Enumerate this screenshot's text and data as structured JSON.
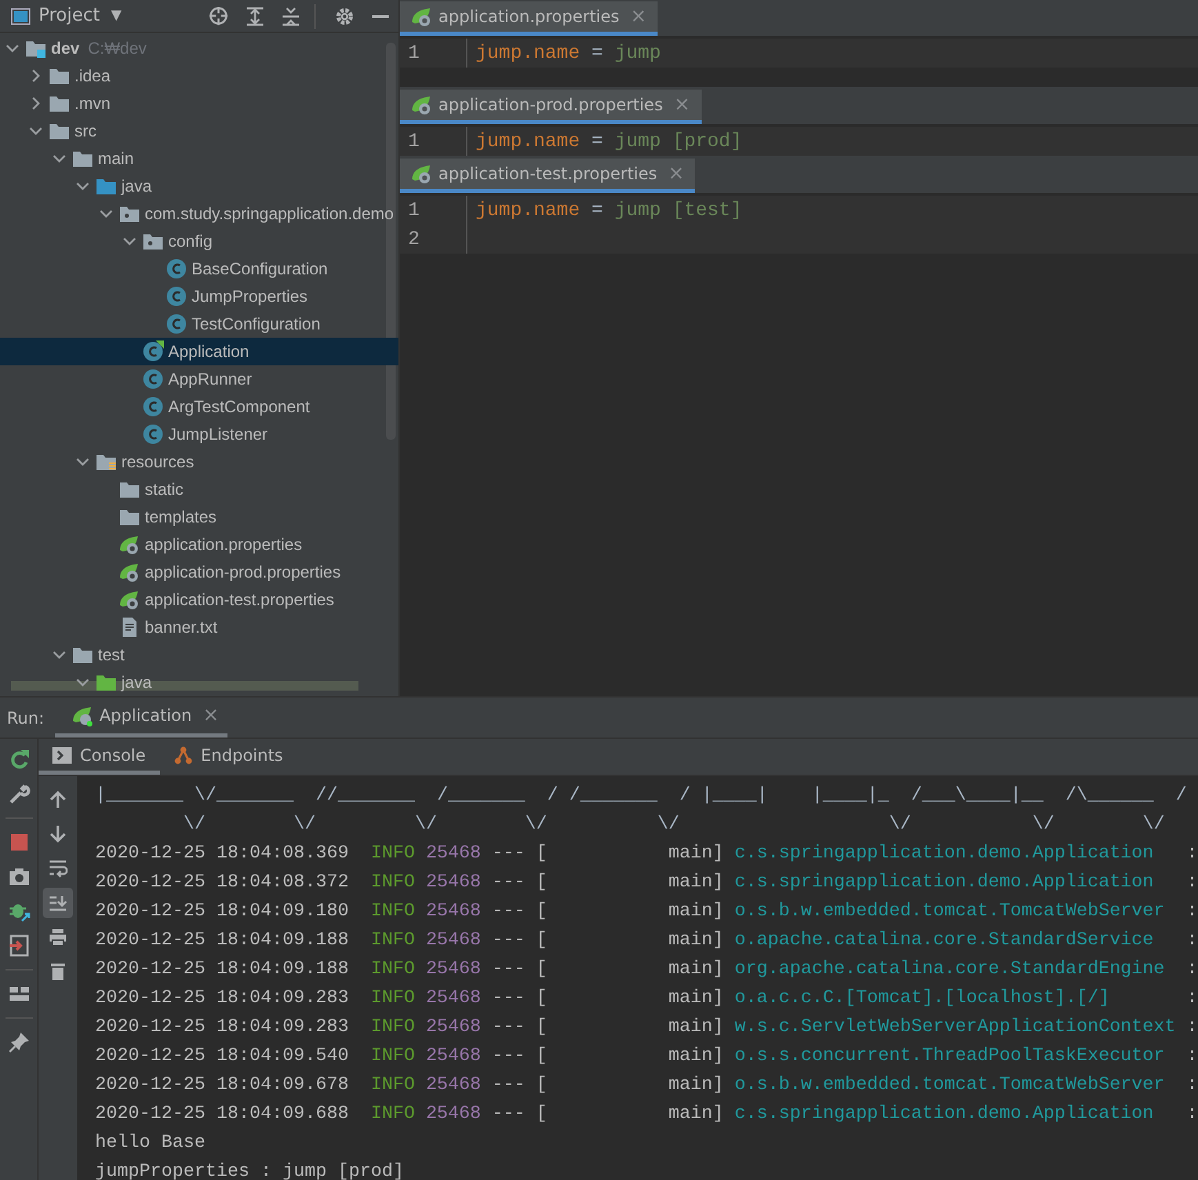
{
  "project_panel": {
    "title": "Project",
    "caret": "▼",
    "tree": [
      {
        "label": "dev",
        "hint": "C:₩dev",
        "kind": "module",
        "expanded": true,
        "selected": false,
        "children": [
          {
            "label": ".idea",
            "kind": "folder",
            "expanded": false,
            "selected": false
          },
          {
            "label": ".mvn",
            "kind": "folder",
            "expanded": false,
            "selected": false
          },
          {
            "label": "src",
            "kind": "folder",
            "expanded": true,
            "selected": false,
            "children": [
              {
                "label": "main",
                "kind": "folder",
                "expanded": true,
                "selected": false,
                "children": [
                  {
                    "label": "java",
                    "kind": "source",
                    "expanded": true,
                    "selected": false,
                    "children": [
                      {
                        "label": "com.study.springapplication.demo",
                        "kind": "package",
                        "expanded": true,
                        "selected": false,
                        "children": [
                          {
                            "label": "config",
                            "kind": "package",
                            "expanded": true,
                            "selected": false,
                            "children": [
                              {
                                "label": "BaseConfiguration",
                                "kind": "class",
                                "selected": false
                              },
                              {
                                "label": "JumpProperties",
                                "kind": "class",
                                "selected": false
                              },
                              {
                                "label": "TestConfiguration",
                                "kind": "class",
                                "selected": false
                              }
                            ]
                          },
                          {
                            "label": "Application",
                            "kind": "spring-class",
                            "selected": true
                          },
                          {
                            "label": "AppRunner",
                            "kind": "class",
                            "selected": false
                          },
                          {
                            "label": "ArgTestComponent",
                            "kind": "class",
                            "selected": false
                          },
                          {
                            "label": "JumpListener",
                            "kind": "class",
                            "selected": false
                          }
                        ]
                      }
                    ]
                  },
                  {
                    "label": "resources",
                    "kind": "resources",
                    "expanded": true,
                    "selected": false,
                    "children": [
                      {
                        "label": "static",
                        "kind": "folder",
                        "selected": false
                      },
                      {
                        "label": "templates",
                        "kind": "folder",
                        "selected": false
                      },
                      {
                        "label": "application.properties",
                        "kind": "properties",
                        "selected": false
                      },
                      {
                        "label": "application-prod.properties",
                        "kind": "properties",
                        "selected": false
                      },
                      {
                        "label": "application-test.properties",
                        "kind": "properties",
                        "selected": false
                      },
                      {
                        "label": "banner.txt",
                        "kind": "text",
                        "selected": false
                      }
                    ]
                  }
                ]
              },
              {
                "label": "test",
                "kind": "folder",
                "expanded": true,
                "selected": false,
                "children": [
                  {
                    "label": "java",
                    "kind": "test-source",
                    "expanded": true,
                    "selected": false
                  }
                ]
              }
            ]
          }
        ]
      }
    ]
  },
  "editors": [
    {
      "tab": "application.properties",
      "close": "×",
      "lines": [
        {
          "number": "1",
          "key": "jump.name",
          "op": "=",
          "value": "jump"
        }
      ]
    },
    {
      "tab": "application-prod.properties",
      "close": "×",
      "lines": [
        {
          "number": "1",
          "key": "jump.name",
          "op": "=",
          "value": "jump [prod]"
        }
      ]
    },
    {
      "tab": "application-test.properties",
      "close": "×",
      "lines": [
        {
          "number": "1",
          "key": "jump.name",
          "op": "=",
          "value": "jump [test]"
        },
        {
          "number": "2"
        }
      ]
    }
  ],
  "run_panel": {
    "label": "Run:",
    "tab": "Application",
    "close": "×",
    "subtabs": [
      {
        "label": "Console",
        "kind": "console",
        "selected": true
      },
      {
        "label": "Endpoints",
        "kind": "endpoints",
        "selected": false
      }
    ],
    "side_tools": [
      {
        "kind": "rerun"
      },
      {
        "kind": "wrench"
      },
      {
        "kind": "stop"
      },
      {
        "kind": "camera"
      },
      {
        "kind": "bug"
      },
      {
        "kind": "exit"
      },
      {
        "kind": "layout"
      },
      {
        "kind": "pin"
      }
    ],
    "console_tools": [
      {
        "kind": "up",
        "on": false
      },
      {
        "kind": "down",
        "on": false
      },
      {
        "kind": "wrap",
        "on": false
      },
      {
        "kind": "scroll-end",
        "on": true
      },
      {
        "kind": "print",
        "on": false
      },
      {
        "kind": "trash",
        "on": false
      }
    ],
    "console": [
      {
        "kind": "banner",
        "text": "|_______ \\/_______  //_______  /_______  / /_______  / |____|    |____|_  /___\\____|__  /\\______  /"
      },
      {
        "kind": "banner",
        "text": "        \\/        \\/         \\/        \\/          \\/                   \\/           \\/        \\/"
      },
      {
        "kind": "log",
        "time": "2020-12-25 18:04:08.369",
        "level": "INFO",
        "pid": "25468",
        "thread": "--- [           main]",
        "logger": "c.s.springapplication.demo.Application",
        "colon": ":"
      },
      {
        "kind": "log",
        "time": "2020-12-25 18:04:08.372",
        "level": "INFO",
        "pid": "25468",
        "thread": "--- [           main]",
        "logger": "c.s.springapplication.demo.Application",
        "colon": ":"
      },
      {
        "kind": "log",
        "time": "2020-12-25 18:04:09.180",
        "level": "INFO",
        "pid": "25468",
        "thread": "--- [           main]",
        "logger": "o.s.b.w.embedded.tomcat.TomcatWebServer",
        "colon": ":"
      },
      {
        "kind": "log",
        "time": "2020-12-25 18:04:09.188",
        "level": "INFO",
        "pid": "25468",
        "thread": "--- [           main]",
        "logger": "o.apache.catalina.core.StandardService",
        "colon": ":"
      },
      {
        "kind": "log",
        "time": "2020-12-25 18:04:09.188",
        "level": "INFO",
        "pid": "25468",
        "thread": "--- [           main]",
        "logger": "org.apache.catalina.core.StandardEngine",
        "colon": ":"
      },
      {
        "kind": "log",
        "time": "2020-12-25 18:04:09.283",
        "level": "INFO",
        "pid": "25468",
        "thread": "--- [           main]",
        "logger": "o.a.c.c.C.[Tomcat].[localhost].[/]",
        "colon": ":"
      },
      {
        "kind": "log",
        "time": "2020-12-25 18:04:09.283",
        "level": "INFO",
        "pid": "25468",
        "thread": "--- [           main]",
        "logger": "w.s.c.ServletWebServerApplicationContext",
        "colon": ":"
      },
      {
        "kind": "log",
        "time": "2020-12-25 18:04:09.540",
        "level": "INFO",
        "pid": "25468",
        "thread": "--- [           main]",
        "logger": "o.s.s.concurrent.ThreadPoolTaskExecutor",
        "colon": ":"
      },
      {
        "kind": "log",
        "time": "2020-12-25 18:04:09.678",
        "level": "INFO",
        "pid": "25468",
        "thread": "--- [           main]",
        "logger": "o.s.b.w.embedded.tomcat.TomcatWebServer",
        "colon": ":"
      },
      {
        "kind": "log",
        "time": "2020-12-25 18:04:09.688",
        "level": "INFO",
        "pid": "25468",
        "thread": "--- [           main]",
        "logger": "c.s.springapplication.demo.Application",
        "colon": ":"
      },
      {
        "kind": "plain",
        "text": "hello Base"
      },
      {
        "kind": "plain",
        "text": "jumpProperties : jump [prod]"
      }
    ]
  }
}
